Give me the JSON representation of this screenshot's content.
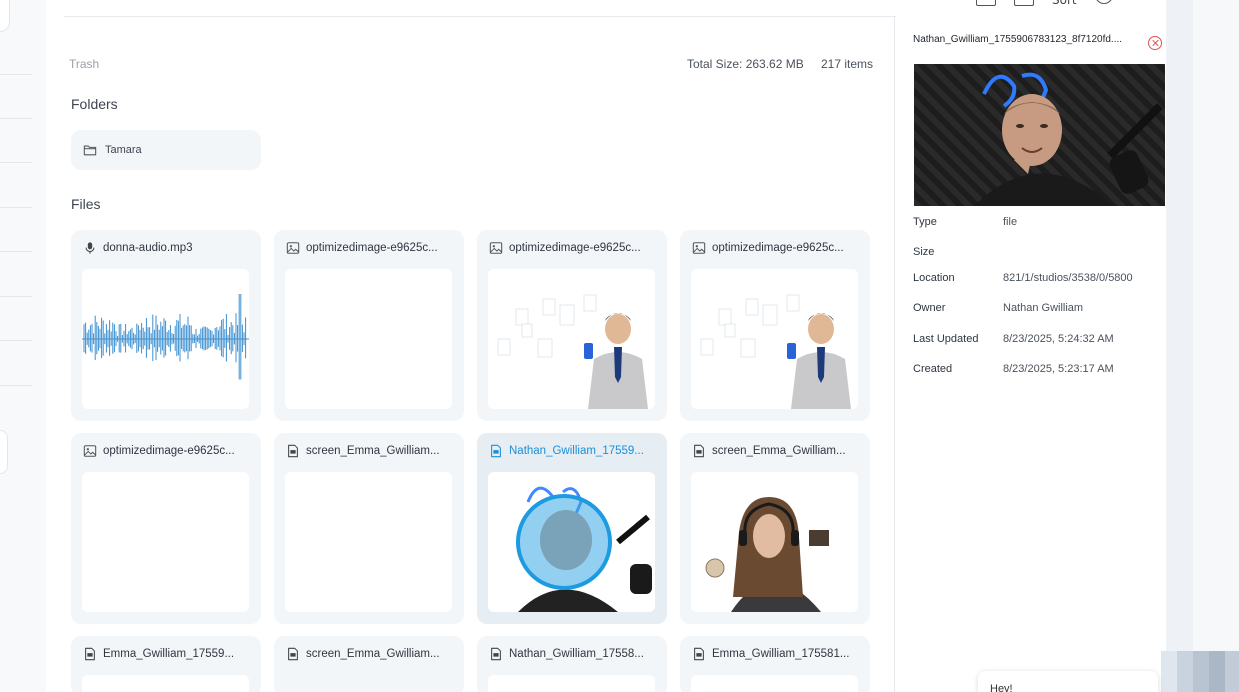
{
  "toolbar": {
    "sort_label": "Sort"
  },
  "breadcrumb": {
    "trash": "Trash"
  },
  "summary": {
    "total_size": "Total Size: 263.62 MB",
    "item_count": "217 items"
  },
  "sections": {
    "folders": "Folders",
    "files": "Files"
  },
  "folders": [
    {
      "name": "Tamara",
      "icon": "folder-icon"
    }
  ],
  "files": [
    {
      "name": "donna-audio.mp3",
      "icon": "microphone-icon",
      "thumb": "waveform"
    },
    {
      "name": "optimizedimage-e9625c...",
      "icon": "image-icon",
      "thumb": "blank"
    },
    {
      "name": "optimizedimage-e9625c...",
      "icon": "image-icon",
      "thumb": "office"
    },
    {
      "name": "optimizedimage-e9625c...",
      "icon": "image-icon",
      "thumb": "office"
    },
    {
      "name": "optimizedimage-e9625c...",
      "icon": "image-icon",
      "thumb": "blank"
    },
    {
      "name": "screen_Emma_Gwilliam...",
      "icon": "video-file-icon",
      "thumb": "blank"
    },
    {
      "name": "Nathan_Gwilliam_17559...",
      "icon": "video-file-icon",
      "thumb": "studio-selected",
      "selected": true
    },
    {
      "name": "screen_Emma_Gwilliam...",
      "icon": "video-file-icon",
      "thumb": "room"
    },
    {
      "name": "Emma_Gwilliam_17559...",
      "icon": "video-file-icon",
      "thumb": "room"
    },
    {
      "name": "screen_Emma_Gwilliam...",
      "icon": "video-file-icon",
      "thumb": "blank"
    },
    {
      "name": "Nathan_Gwilliam_17558...",
      "icon": "video-file-icon",
      "thumb": "studio"
    },
    {
      "name": "Emma_Gwilliam_175581...",
      "icon": "video-file-icon",
      "thumb": "room"
    }
  ],
  "details": {
    "title": "Nathan_Gwilliam_1755906783123_8f7120fd....",
    "rows": [
      {
        "key": "Type",
        "value": "file"
      },
      {
        "key": "Size",
        "value": ""
      },
      {
        "key": "Location",
        "value": "821/1/studios/3538/0/5800"
      },
      {
        "key": "Owner",
        "value": "Nathan Gwilliam"
      },
      {
        "key": "Last Updated",
        "value": "8/23/2025, 5:24:32 AM"
      },
      {
        "key": "Created",
        "value": "8/23/2025, 5:23:17 AM"
      }
    ]
  },
  "chat": {
    "greeting": "Hey!"
  },
  "colors": {
    "accent": "#1c8fd8",
    "close": "#e05050"
  }
}
